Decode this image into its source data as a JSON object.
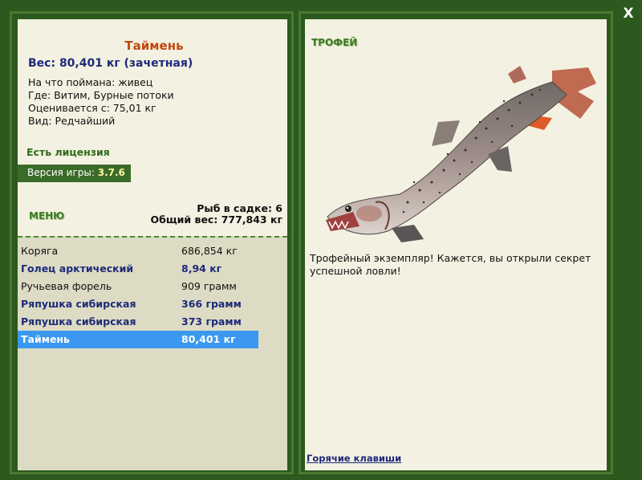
{
  "close_label": "X",
  "catch": {
    "name": "Таймень",
    "weight": "Вес: 80,401 кг (зачетная)",
    "bait": "На что поймана: живец",
    "location": "Где: Витим, Бурные потоки",
    "valued_from": "Оценивается с: 75,01 кг",
    "rarity": "Вид: Редчайший"
  },
  "license": "Есть лицензия",
  "version": {
    "label": "Версия игры: ",
    "value": "3.7.6"
  },
  "menu_label": "МЕНЮ",
  "cage": {
    "count": "Рыб в садке: 6",
    "total": "Общий вес: 777,843 кг"
  },
  "fish_list": [
    {
      "name": "Коряга",
      "weight": "686,854 кг"
    },
    {
      "name": "Голец арктический",
      "weight": "8,94 кг"
    },
    {
      "name": "Ручьевая форель",
      "weight": "909 грамм"
    },
    {
      "name": "Ряпушка сибирская",
      "weight": "366 грамм"
    },
    {
      "name": "Ряпушка сибирская",
      "weight": "373 грамм"
    },
    {
      "name": "Таймень",
      "weight": "80,401 кг"
    }
  ],
  "trophy": {
    "title": "ТРОФЕЙ",
    "text": "Трофейный экземпляр! Кажется, вы открыли секрет успешной ловли!",
    "hotkeys": "Горячие клавиши"
  },
  "colors": {
    "background": "#2c5a1e",
    "panel": "#f3f1e1",
    "list": "#dddbc3",
    "selected": "#3a98f0",
    "fish_name": "#c04810",
    "bold_text": "#1d2a7a"
  }
}
